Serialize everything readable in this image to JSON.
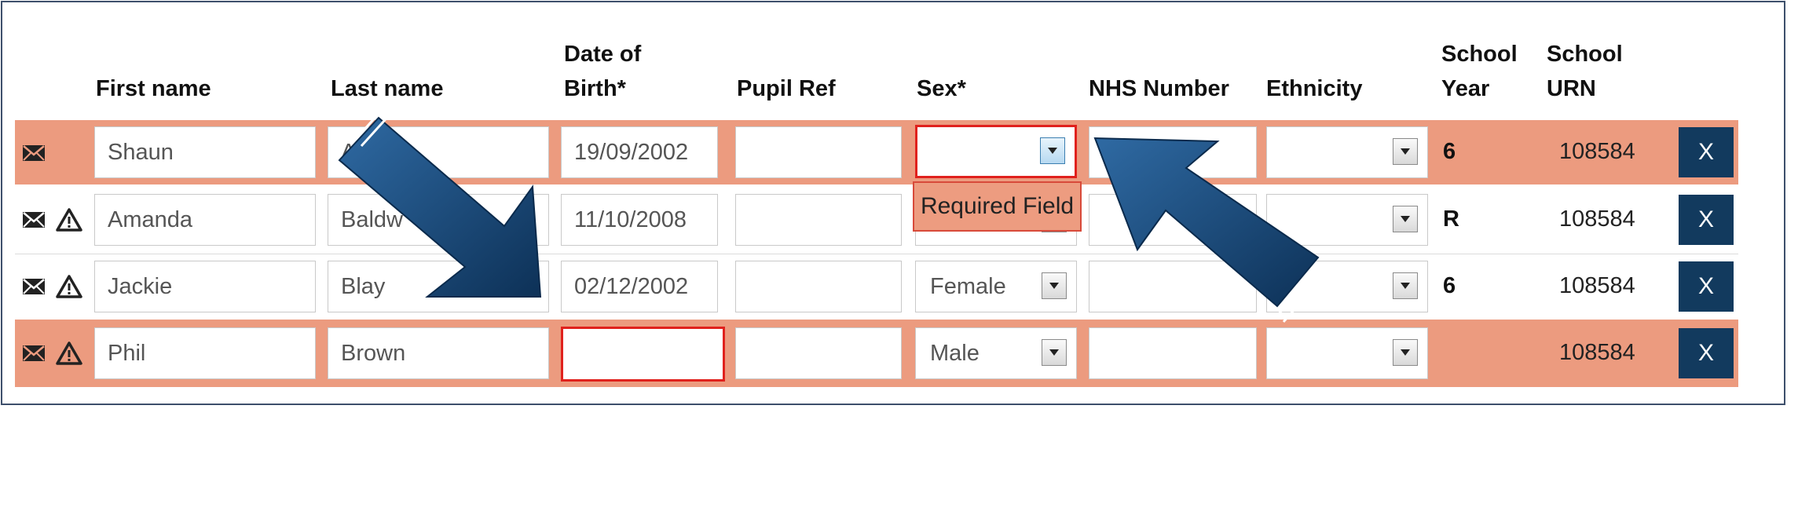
{
  "headers": {
    "first_name": "First name",
    "last_name": "Last name",
    "dob_line1": "Date of",
    "dob_line2": "Birth*",
    "pupil_ref": "Pupil Ref",
    "sex": "Sex*",
    "nhs": "NHS Number",
    "ethnicity": "Ethnicity",
    "school_year_line1": "School",
    "school_year_line2": "Year",
    "school_urn_line1": "School",
    "school_urn_line2": "URN"
  },
  "rows": [
    {
      "first_name": "Shaun",
      "last_name": "Ac",
      "dob": "19/09/2002",
      "pupil_ref": "",
      "sex": "",
      "nhs": "",
      "ethnicity": "",
      "year": "6",
      "urn": "108584",
      "remove": "X"
    },
    {
      "first_name": "Amanda",
      "last_name": "Baldw",
      "dob": "11/10/2008",
      "pupil_ref": "",
      "sex": "",
      "nhs": "",
      "ethnicity": "",
      "year": "R",
      "urn": "108584",
      "remove": "X"
    },
    {
      "first_name": "Jackie",
      "last_name": "Blay",
      "dob": "02/12/2002",
      "pupil_ref": "",
      "sex": "Female",
      "nhs": "",
      "ethnicity": "",
      "year": "6",
      "urn": "108584",
      "remove": "X"
    },
    {
      "first_name": "Phil",
      "last_name": "Brown",
      "dob": "",
      "pupil_ref": "",
      "sex": "Male",
      "nhs": "",
      "ethnicity": "",
      "year": "",
      "urn": "108584",
      "remove": "X"
    }
  ],
  "tooltip": {
    "text": "Required Field"
  },
  "icons": {
    "mail": "envelope-icon",
    "warning": "warning-triangle-icon",
    "dropdown": "chevron-down-icon",
    "arrow": "arrow-annotation"
  },
  "colors": {
    "row_highlight": "#ec9b7f",
    "error": "#e0211d",
    "button": "#123a5e",
    "arrow": "#0f3a63"
  }
}
